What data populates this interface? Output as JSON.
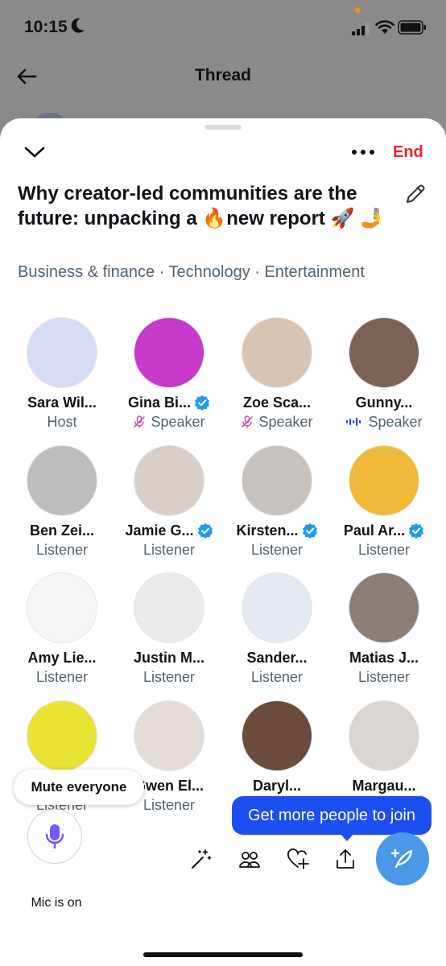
{
  "status": {
    "time": "10:15"
  },
  "header": {
    "title": "Thread"
  },
  "sheet": {
    "end_label": "End",
    "title": "Why creator-led communities are the future: unpacking a 🔥new report 🚀 🤳",
    "topics": "Business & finance · Technology · Entertainment"
  },
  "participants": [
    {
      "name": "Sara Wil...",
      "role": "Host",
      "role_icon": "none",
      "verified": false,
      "avatar_color": "#d6dcf5"
    },
    {
      "name": "Gina Bi...",
      "role": "Speaker",
      "role_icon": "mic-off-icon",
      "verified": true,
      "avatar_color": "#c639c9"
    },
    {
      "name": "Zoe Sca...",
      "role": "Speaker",
      "role_icon": "mic-off-icon",
      "verified": false,
      "avatar_color": "#d8c4b2"
    },
    {
      "name": "Gunny...",
      "role": "Speaker",
      "role_icon": "speaking-icon",
      "verified": false,
      "avatar_color": "#7b6355"
    },
    {
      "name": "Ben Zei...",
      "role": "Listener",
      "role_icon": "none",
      "verified": false,
      "avatar_color": "#bdbdbd"
    },
    {
      "name": "Jamie G...",
      "role": "Listener",
      "role_icon": "none",
      "verified": true,
      "avatar_color": "#d9cfc6"
    },
    {
      "name": "Kirsten...",
      "role": "Listener",
      "role_icon": "none",
      "verified": true,
      "avatar_color": "#c7c2be"
    },
    {
      "name": "Paul Ar...",
      "role": "Listener",
      "role_icon": "none",
      "verified": true,
      "avatar_color": "#f0b93a"
    },
    {
      "name": "Amy Lie...",
      "role": "Listener",
      "role_icon": "none",
      "verified": false,
      "avatar_color": "#f6f6f7"
    },
    {
      "name": "Justin M...",
      "role": "Listener",
      "role_icon": "none",
      "verified": false,
      "avatar_color": "#ebebeb"
    },
    {
      "name": "Sander...",
      "role": "Listener",
      "role_icon": "none",
      "verified": false,
      "avatar_color": "#e4eaf2"
    },
    {
      "name": "Matias J...",
      "role": "Listener",
      "role_icon": "none",
      "verified": false,
      "avatar_color": "#8c7f78"
    },
    {
      "name": "",
      "role": "Listener",
      "role_icon": "none",
      "verified": false,
      "avatar_color": "#e8e232"
    },
    {
      "name": "Gwen El...",
      "role": "Listener",
      "role_icon": "none",
      "verified": false,
      "avatar_color": "#e3ddd6"
    },
    {
      "name": "Daryl...",
      "role": "",
      "role_icon": "none",
      "verified": false,
      "avatar_color": "#6b4b3c"
    },
    {
      "name": "Margau...",
      "role": "",
      "role_icon": "none",
      "verified": false,
      "avatar_color": "#dcd6d2"
    }
  ],
  "controls": {
    "mute_everyone": "Mute everyone",
    "join_tooltip": "Get more people to join",
    "mic_label": "Mic is on"
  },
  "colors": {
    "end_red": "#f4212e",
    "accent_blue": "#1d9bf0",
    "tooltip_blue": "#1d4ff0",
    "mic_purple": "#7856ff",
    "fab_blue": "#4a99e9"
  }
}
